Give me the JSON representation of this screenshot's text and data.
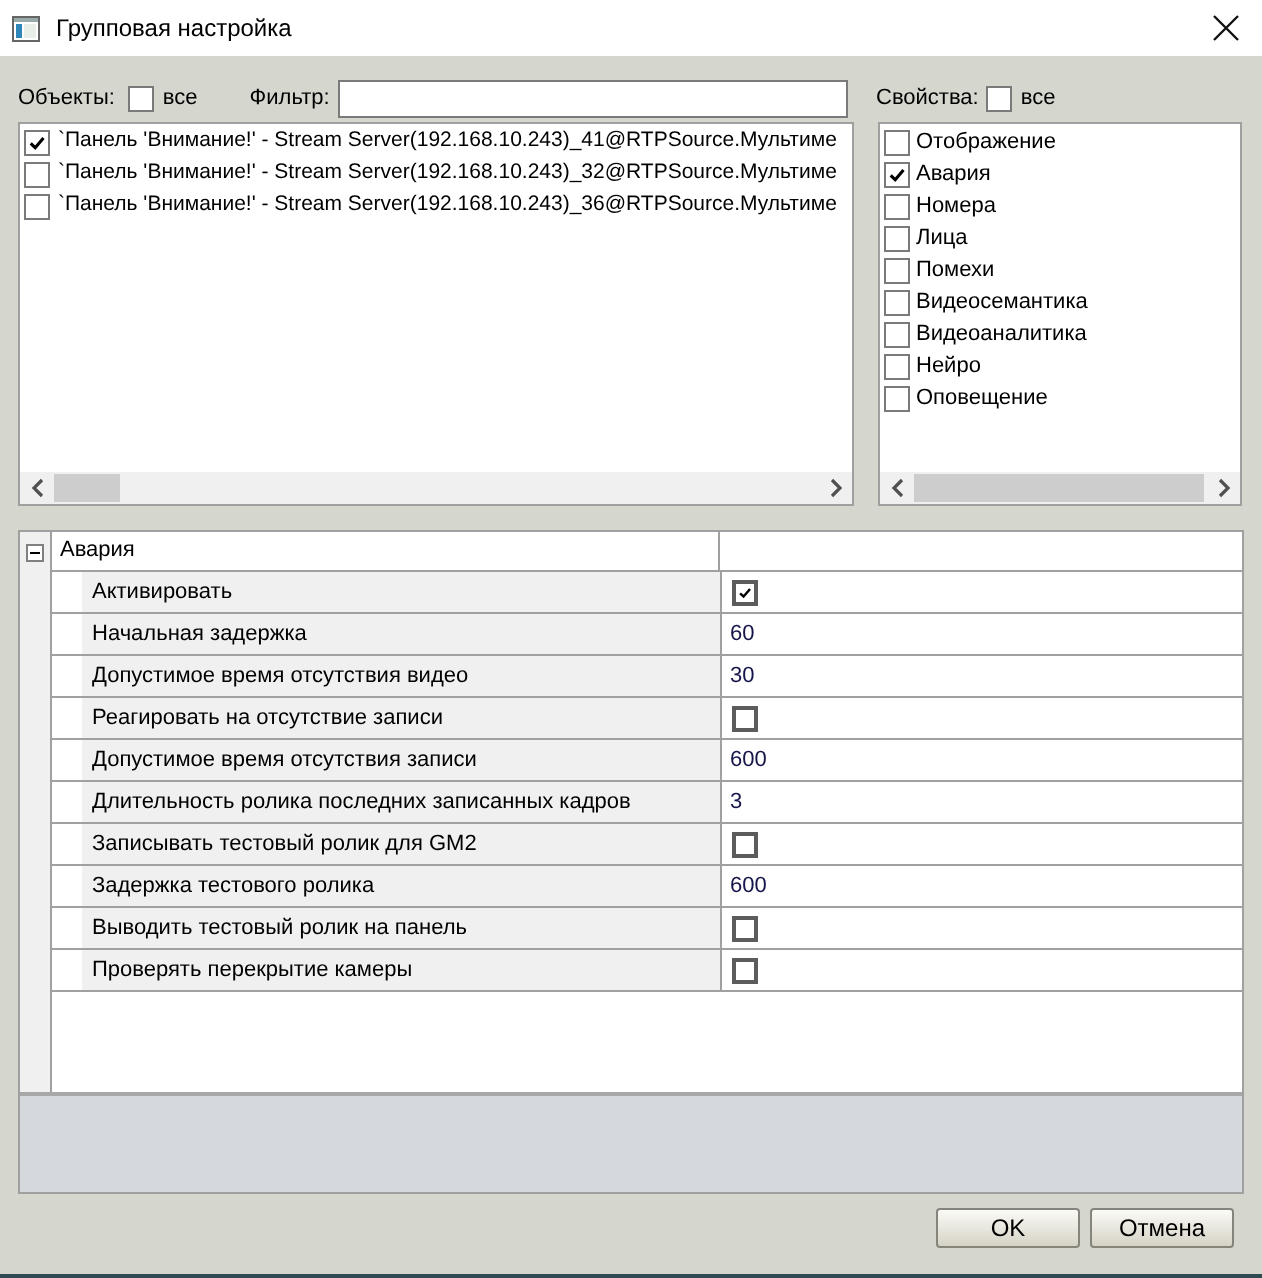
{
  "window": {
    "title": "Групповая настройка"
  },
  "objects": {
    "label": "Объекты:",
    "select_all": {
      "label": "все",
      "checked": false
    },
    "filter": {
      "label": "Фильтр:"
    },
    "items": [
      {
        "text": "`Панель 'Внимание!' - Stream Server(192.168.10.243)_41@RTPSource.Мультиме",
        "checked": true
      },
      {
        "text": "`Панель 'Внимание!' - Stream Server(192.168.10.243)_32@RTPSource.Мультиме",
        "checked": false
      },
      {
        "text": "`Панель 'Внимание!' - Stream Server(192.168.10.243)_36@RTPSource.Мультиме",
        "checked": false
      }
    ]
  },
  "properties": {
    "label": "Свойства:",
    "select_all": {
      "label": "все",
      "checked": false
    },
    "items": [
      {
        "label": "Отображение",
        "checked": false
      },
      {
        "label": "Авария",
        "checked": true
      },
      {
        "label": "Номера",
        "checked": false
      },
      {
        "label": "Лица",
        "checked": false
      },
      {
        "label": "Помехи",
        "checked": false
      },
      {
        "label": "Видеосемантика",
        "checked": false
      },
      {
        "label": "Видеоаналитика",
        "checked": false
      },
      {
        "label": "Нейро",
        "checked": false
      },
      {
        "label": "Оповещение",
        "checked": false
      }
    ]
  },
  "property_grid": {
    "categories": [
      {
        "label": "Авария",
        "expanded": true,
        "rows": [
          {
            "name": "Активировать",
            "kind": "checkbox",
            "checked": true
          },
          {
            "name": "Начальная задержка",
            "kind": "text",
            "value": "60"
          },
          {
            "name": "Допустимое время отсутствия видео",
            "kind": "text",
            "value": "30"
          },
          {
            "name": "Реагировать на отсутствие записи",
            "kind": "checkbox",
            "checked": false
          },
          {
            "name": "Допустимое время отсутствия записи",
            "kind": "text",
            "value": "600"
          },
          {
            "name": "Длительность ролика последних записанных кадров",
            "kind": "text",
            "value": "3"
          },
          {
            "name": "Записывать тестовый ролик для GM2",
            "kind": "checkbox",
            "checked": false
          },
          {
            "name": "Задержка тестового ролика",
            "kind": "text",
            "value": "600"
          },
          {
            "name": "Выводить тестовый ролик на панель",
            "kind": "checkbox",
            "checked": false
          },
          {
            "name": "Проверять перекрытие камеры",
            "kind": "checkbox",
            "checked": false
          }
        ]
      }
    ]
  },
  "buttons": [
    {
      "label": "OK"
    },
    {
      "label": "Отмена"
    }
  ]
}
